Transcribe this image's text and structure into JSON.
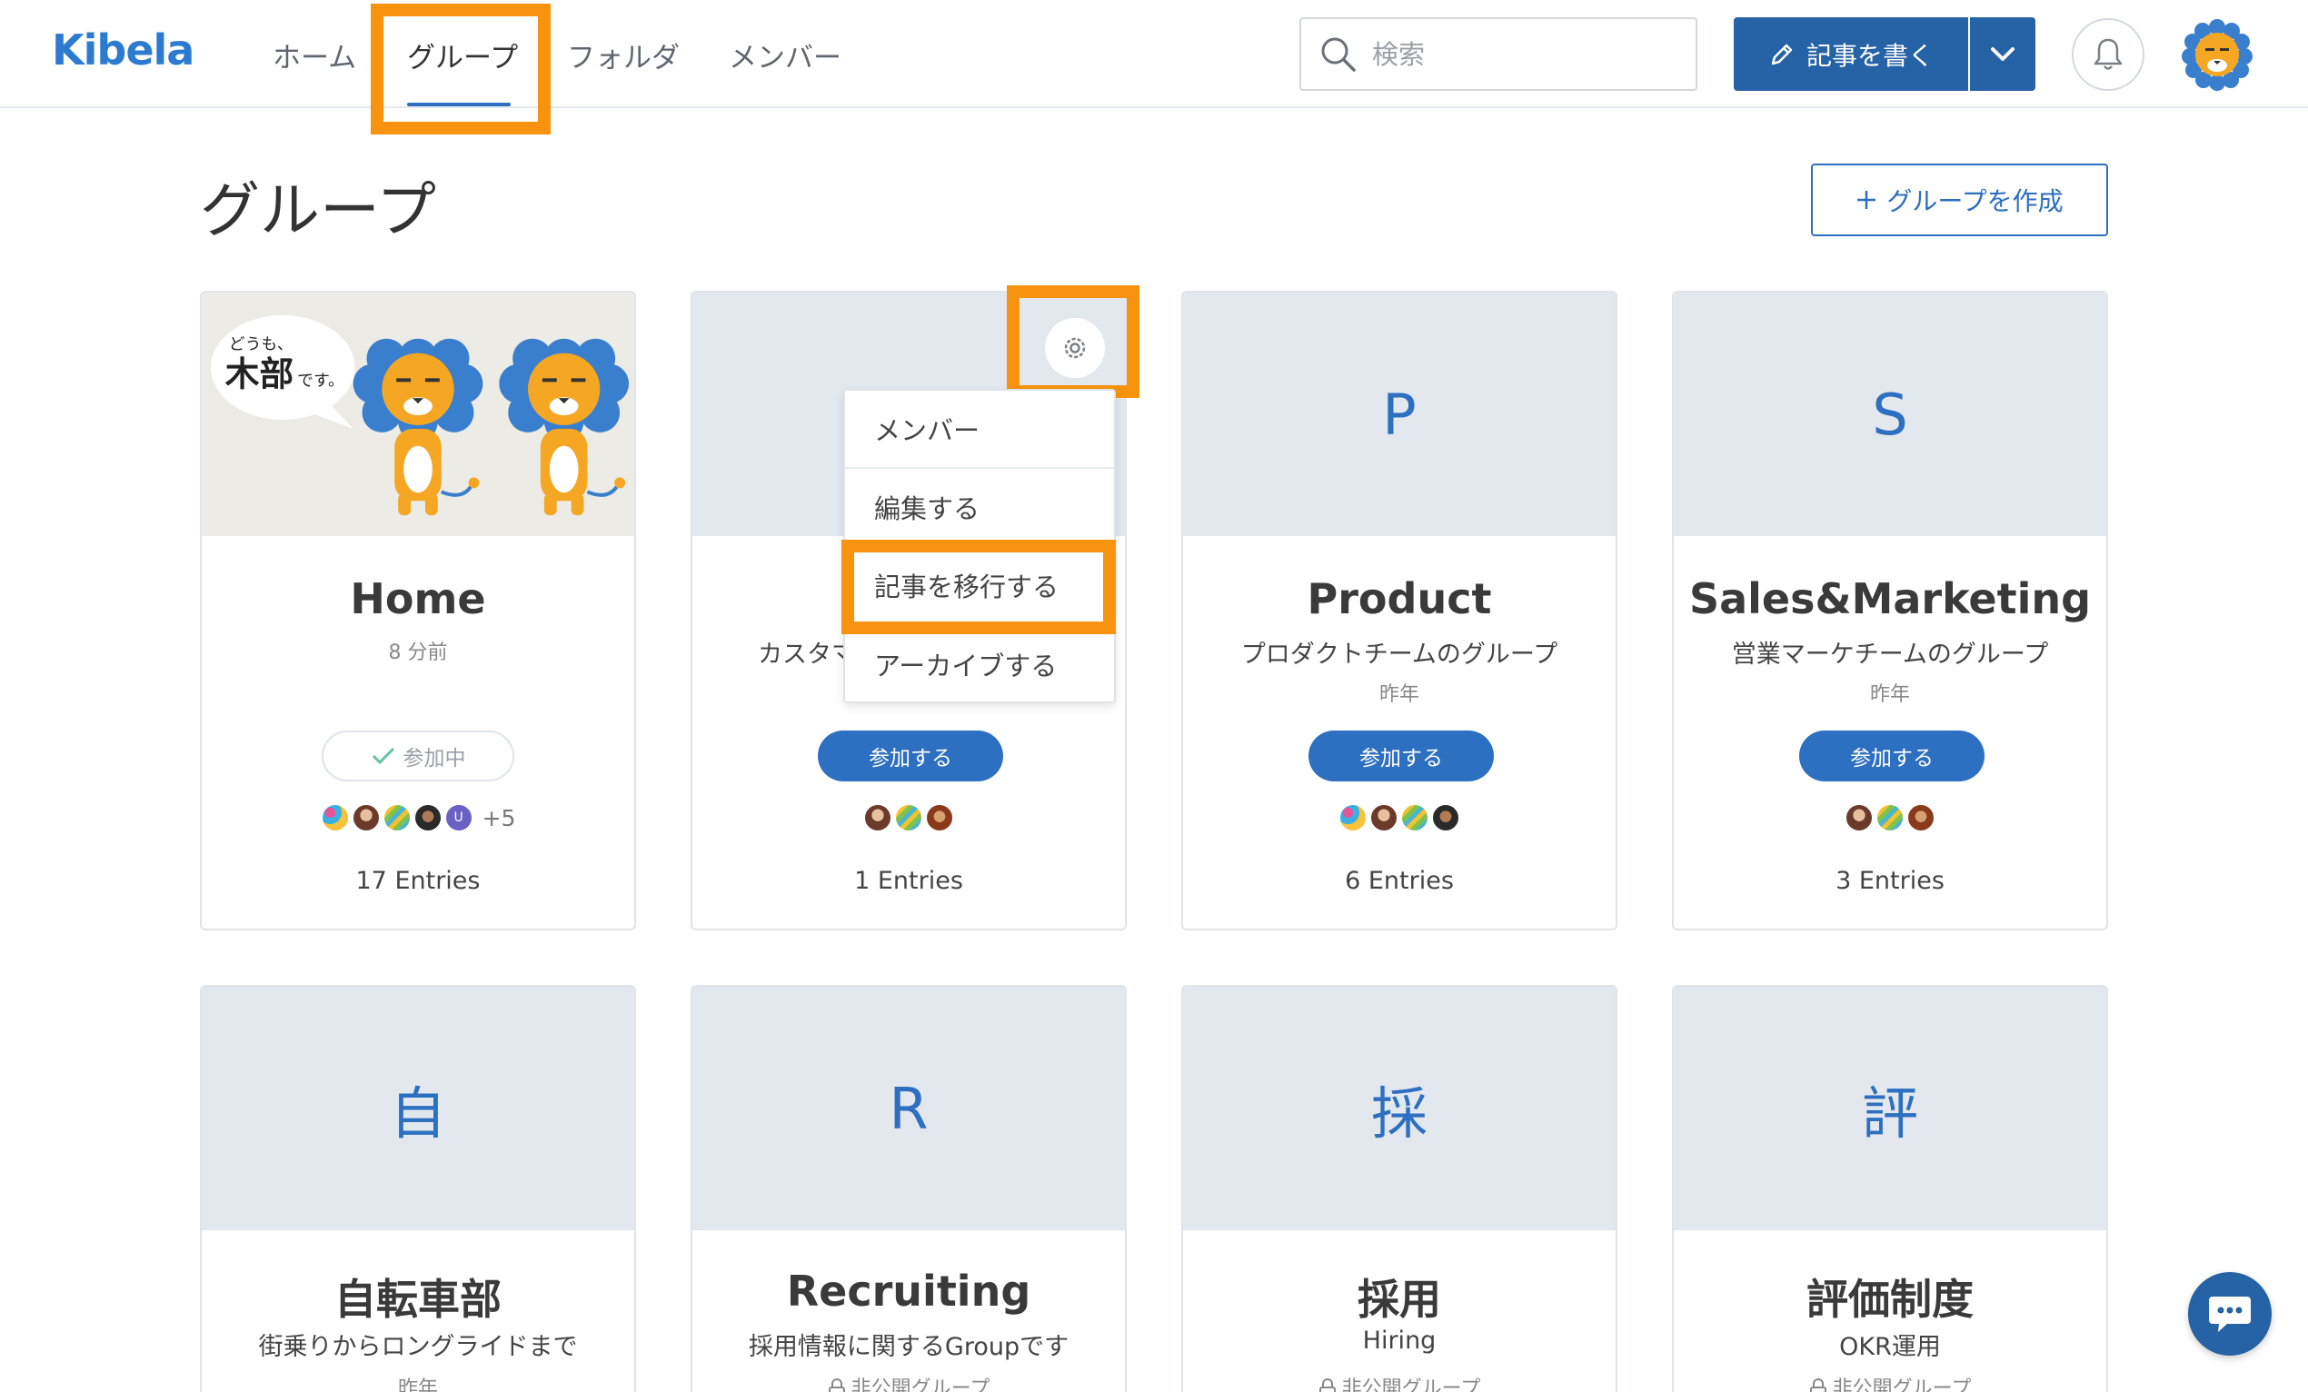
{
  "header": {
    "logo": "Kibela",
    "nav": [
      "ホーム",
      "グループ",
      "フォルダ",
      "メンバー"
    ],
    "search_placeholder": "検索",
    "write_label": "記事を書く"
  },
  "page": {
    "title": "グループ",
    "create_label": "グループを作成"
  },
  "home_banner": {
    "speech_small": "どうも、",
    "speech_big": "木部",
    "speech_suffix": "です。"
  },
  "cards": [
    {
      "name": "Home",
      "time": "8 分前",
      "status": "参加中",
      "extra_members": "+5",
      "entries": "17 Entries"
    },
    {
      "desc": "カスタマ",
      "join": "参加する",
      "entries": "1 Entries"
    },
    {
      "letter": "P",
      "name": "Product",
      "desc": "プロダクトチームのグループ",
      "time": "昨年",
      "join": "参加する",
      "entries": "6 Entries"
    },
    {
      "letter": "S",
      "name": "Sales&Marketing",
      "desc": "営業マーケチームのグループ",
      "time": "昨年",
      "join": "参加する",
      "entries": "3 Entries"
    },
    {
      "letter": "自",
      "name": "自転車部",
      "desc": "街乗りからロングライドまで",
      "time": "昨年"
    },
    {
      "letter": "R",
      "name": "Recruiting",
      "desc": "採用情報に関するGroupです",
      "time": "非公開グループ"
    },
    {
      "letter": "採",
      "name": "採用",
      "desc": "Hiring",
      "time": "非公開グループ"
    },
    {
      "letter": "評",
      "name": "評価制度",
      "desc": "OKR運用",
      "time": "非公開グループ"
    }
  ],
  "menu": [
    "メンバー",
    "編集する",
    "記事を移行する",
    "アーカイブする"
  ],
  "colors": {
    "primary": "#2d6fc0",
    "highlight": "#f7930e",
    "banner": "#e3e8ef"
  }
}
